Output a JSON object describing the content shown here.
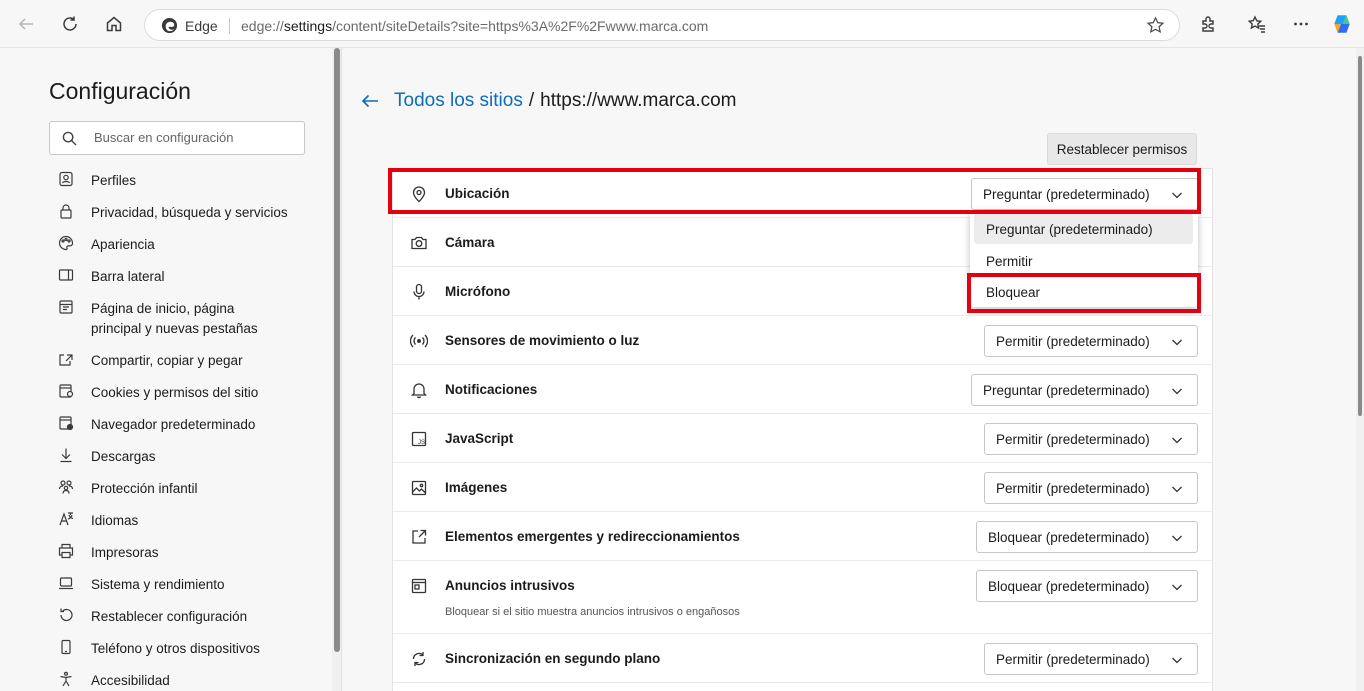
{
  "browser": {
    "edge_label": "Edge",
    "url_prefix": "edge://",
    "url_bold": "settings",
    "url_rest": "/content/siteDetails?site=https%3A%2F%2Fwww.marca.com"
  },
  "sidebar": {
    "title": "Configuración",
    "search_placeholder": "Buscar en configuración",
    "items": [
      {
        "label": "Perfiles",
        "icon": "profile-icon"
      },
      {
        "label": "Privacidad, búsqueda y servicios",
        "icon": "lock-icon"
      },
      {
        "label": "Apariencia",
        "icon": "palette-icon"
      },
      {
        "label": "Barra lateral",
        "icon": "sidebar-icon"
      },
      {
        "label": "Página de inicio, página principal y nuevas pestañas",
        "icon": "home-page-icon"
      },
      {
        "label": "Compartir, copiar y pegar",
        "icon": "share-icon"
      },
      {
        "label": "Cookies y permisos del sitio",
        "icon": "cookies-icon"
      },
      {
        "label": "Navegador predeterminado",
        "icon": "default-browser-icon"
      },
      {
        "label": "Descargas",
        "icon": "download-icon"
      },
      {
        "label": "Protección infantil",
        "icon": "family-icon"
      },
      {
        "label": "Idiomas",
        "icon": "language-icon"
      },
      {
        "label": "Impresoras",
        "icon": "printer-icon"
      },
      {
        "label": "Sistema y rendimiento",
        "icon": "laptop-icon"
      },
      {
        "label": "Restablecer configuración",
        "icon": "reset-icon"
      },
      {
        "label": "Teléfono y otros dispositivos",
        "icon": "phone-icon"
      },
      {
        "label": "Accesibilidad",
        "icon": "accessibility-icon"
      }
    ]
  },
  "main": {
    "breadcrumb_link": "Todos los sitios",
    "breadcrumb_sep": "/",
    "breadcrumb_site": "https://www.marca.com",
    "reset_button": "Restablecer permisos",
    "permissions": [
      {
        "label": "Ubicación",
        "value": "Preguntar (predeterminado)",
        "icon": "location-icon"
      },
      {
        "label": "Cámara",
        "value": "",
        "icon": "camera-icon"
      },
      {
        "label": "Micrófono",
        "value": "",
        "icon": "microphone-icon"
      },
      {
        "label": "Sensores de movimiento o luz",
        "value": "Permitir (predeterminado)",
        "icon": "sensors-icon"
      },
      {
        "label": "Notificaciones",
        "value": "Preguntar (predeterminado)",
        "icon": "bell-icon"
      },
      {
        "label": "JavaScript",
        "value": "Permitir (predeterminado)",
        "icon": "javascript-icon"
      },
      {
        "label": "Imágenes",
        "value": "Permitir (predeterminado)",
        "icon": "image-icon"
      },
      {
        "label": "Elementos emergentes y redireccionamientos",
        "value": "Bloquear (predeterminado)",
        "icon": "popup-icon"
      },
      {
        "label": "Anuncios intrusivos",
        "value": "Bloquear (predeterminado)",
        "icon": "ads-icon",
        "description": "Bloquear si el sitio muestra anuncios intrusivos o engañosos"
      },
      {
        "label": "Sincronización en segundo plano",
        "value": "Permitir (predeterminado)",
        "icon": "sync-icon"
      }
    ],
    "dropdown_menu": {
      "options": [
        "Preguntar (predeterminado)",
        "Permitir",
        "Bloquear"
      ],
      "selected_index": 0
    },
    "highlight_color": "#e3000f",
    "accent_color": "#0f6cbd"
  }
}
